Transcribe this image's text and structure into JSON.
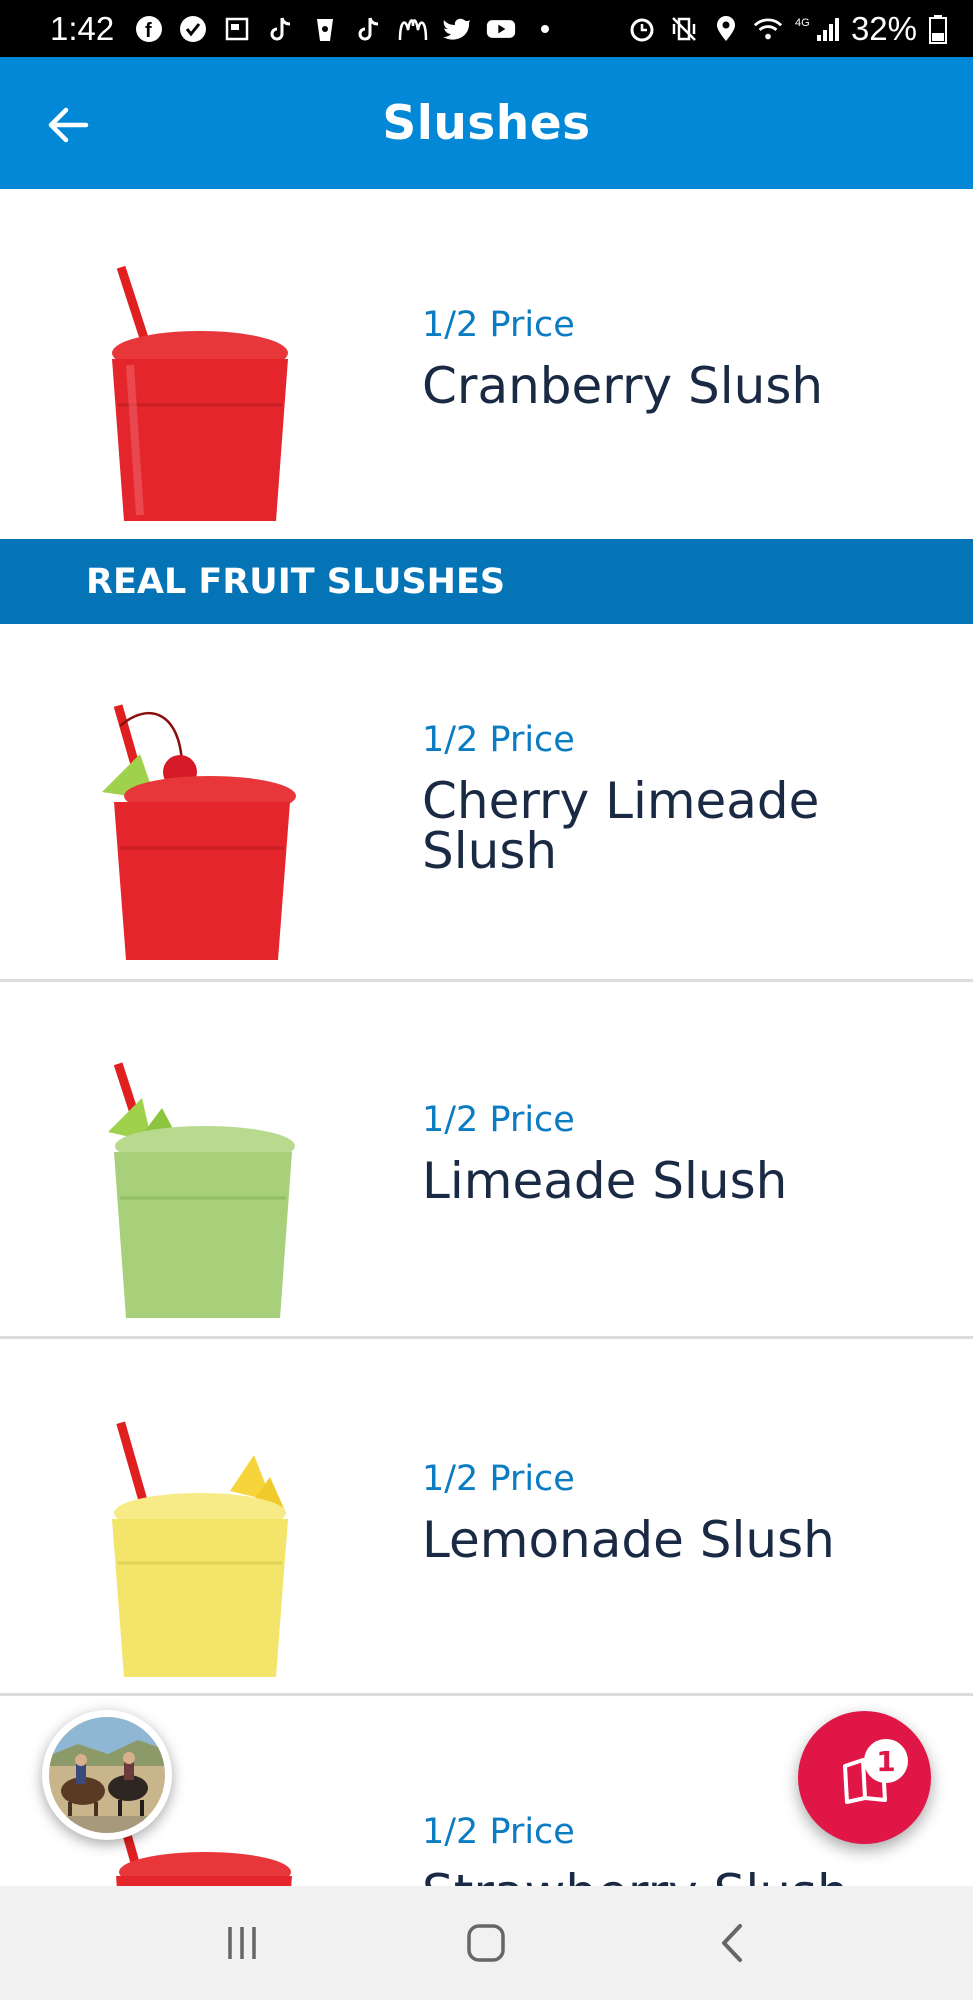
{
  "status_bar": {
    "time": "1:42",
    "battery": "32%",
    "network": "4G",
    "left_icons": [
      "facebook-icon",
      "check-icon",
      "news-icon",
      "tiktok-icon",
      "cup-icon",
      "tiktok-icon",
      "mcdonalds-icon",
      "twitter-icon",
      "youtube-icon",
      "dot-icon"
    ],
    "right_icons": [
      "alarm-icon",
      "vibrate-icon",
      "location-icon",
      "wifi-icon",
      "signal-icon",
      "battery-icon"
    ]
  },
  "app_bar": {
    "title": "Slushes",
    "back_icon": "back-arrow-icon"
  },
  "items": [
    {
      "price": "1/2 Price",
      "name": "Cranberry Slush",
      "color": "#e4262c"
    },
    {
      "price": "1/2 Price",
      "name": "Cherry Limeade Slush",
      "color": "#e4262c"
    },
    {
      "price": "1/2 Price",
      "name": "Limeade Slush",
      "color": "#a8cf7a"
    },
    {
      "price": "1/2 Price",
      "name": "Lemonade Slush",
      "color": "#f3e56a"
    },
    {
      "price": "1/2 Price",
      "name": "Strawberry Slush",
      "color": "#e4262c"
    }
  ],
  "section": {
    "title": "REAL FRUIT SLUSHES"
  },
  "cart": {
    "count": "1"
  },
  "colors": {
    "app_bar": "#0288d6",
    "section": "#0474b7",
    "price": "#0b7cc1",
    "name": "#1b2a44",
    "cart": "#e01647"
  }
}
